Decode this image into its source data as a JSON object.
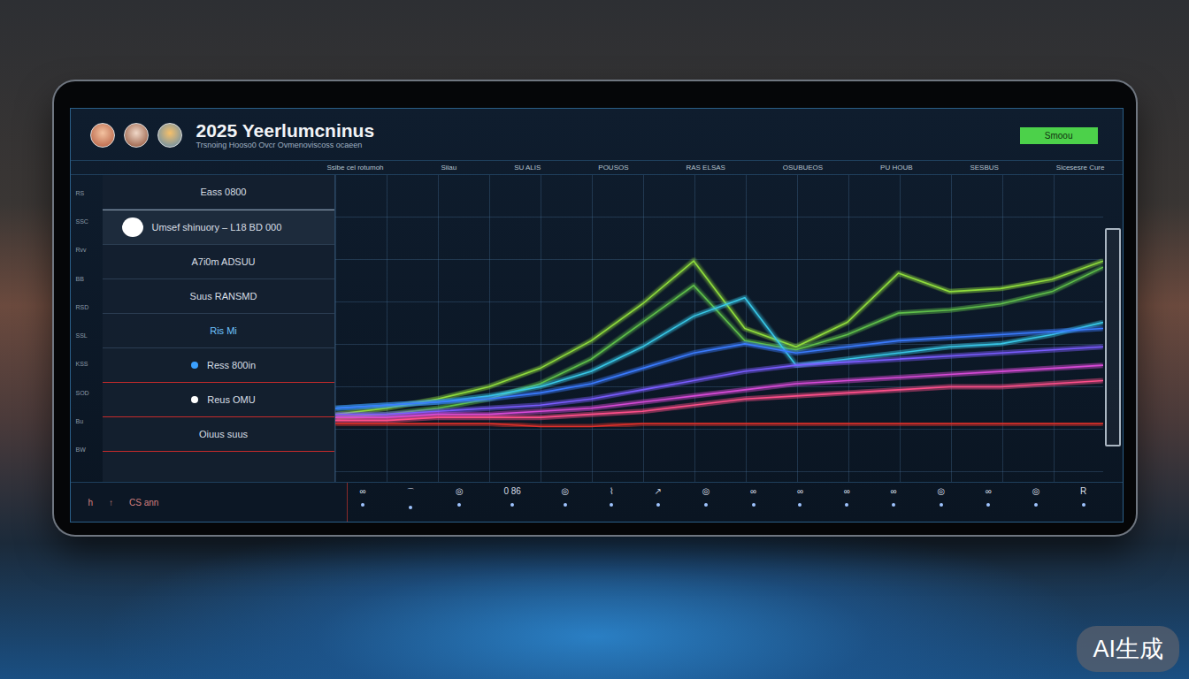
{
  "header": {
    "title": "2025 Yeerlumcninus",
    "subtitle": "Trsnoing Hooso0 Ovcr Ovmenoviscoss ocaeen",
    "button": "Smoou"
  },
  "columns": [
    "Ssibe cel rotumoh",
    "Siiau",
    "SU ALIS",
    "POUSOS",
    "RAS ELSAS",
    "OSUBUEOS",
    "PU HOUB",
    "SESBUS",
    "Sicesesre Cure"
  ],
  "axis_ticks": [
    "RS",
    "SSC",
    "Rvv",
    "BB",
    "RSD",
    "SSL",
    "KSS",
    "SOD",
    "Bu",
    "BW"
  ],
  "panel_rows": [
    {
      "label": "Eass 0800",
      "selected": false,
      "kind": "plain",
      "color": "#d9dfe6"
    },
    {
      "label": "Umsef shinuory – L18 BD 000",
      "selected": true,
      "kind": "dot",
      "color": "#ffffff"
    },
    {
      "label": "A7i0m ADSUU",
      "selected": false,
      "kind": "plain",
      "color": "#d9dfe6"
    },
    {
      "label": "Suus RANSMD",
      "selected": false,
      "kind": "plain",
      "color": "#d9dfe6"
    },
    {
      "label": "Ris Mi",
      "selected": false,
      "kind": "plain",
      "color": "#6fc3ff"
    },
    {
      "label": "Ress 800in",
      "selected": false,
      "kind": "dot",
      "color": "#3aa0ff"
    },
    {
      "label": "Reus OMU",
      "selected": false,
      "kind": "dot",
      "color": "#ffffff"
    },
    {
      "label": "Oiuus suus",
      "selected": false,
      "kind": "plain",
      "color": "#d9dfe6"
    }
  ],
  "chart": {
    "max": 100,
    "series": [
      {
        "values": [
          22,
          24,
          27,
          31,
          37,
          46,
          58,
          72,
          50,
          44,
          52,
          68,
          62,
          63,
          66,
          72
        ],
        "color": "#8fdc3c"
      },
      {
        "values": [
          21,
          22,
          24,
          27,
          32,
          40,
          52,
          64,
          46,
          43,
          48,
          55,
          56,
          58,
          62,
          70
        ],
        "color": "#5fbf4a"
      },
      {
        "values": [
          24,
          25,
          26,
          28,
          31,
          36,
          44,
          54,
          60,
          38,
          40,
          42,
          44,
          45,
          48,
          52
        ],
        "color": "#38c8e8"
      },
      {
        "values": [
          24,
          25,
          26,
          27,
          29,
          32,
          37,
          42,
          45,
          42,
          44,
          46,
          47,
          48,
          49,
          50
        ],
        "color": "#3a7bff"
      },
      {
        "values": [
          22,
          22,
          23,
          24,
          25,
          27,
          30,
          33,
          36,
          38,
          39,
          40,
          41,
          42,
          43,
          44
        ],
        "color": "#7a5cff"
      },
      {
        "values": [
          21,
          21,
          22,
          22,
          23,
          24,
          26,
          28,
          30,
          32,
          33,
          34,
          35,
          36,
          37,
          38
        ],
        "color": "#d84ad8"
      },
      {
        "values": [
          20,
          20,
          21,
          21,
          21,
          22,
          23,
          25,
          27,
          28,
          29,
          30,
          31,
          31,
          32,
          33
        ],
        "color": "#ff4f8a"
      },
      {
        "values": [
          19,
          19,
          19,
          19,
          18,
          18,
          19,
          19,
          19,
          19,
          19,
          19,
          19,
          19,
          19,
          19
        ],
        "color": "#e0302a"
      }
    ]
  },
  "bottom": {
    "left_labels": [
      "h",
      "↑",
      "CS ann"
    ],
    "marks": [
      "∞",
      "⌒",
      "◎",
      "0 86",
      "◎",
      "⌇",
      "↗",
      "◎",
      "∞",
      "∞",
      "∞",
      "∞",
      "◎",
      "∞",
      "◎",
      "R"
    ]
  },
  "watermark": "AI生成"
}
